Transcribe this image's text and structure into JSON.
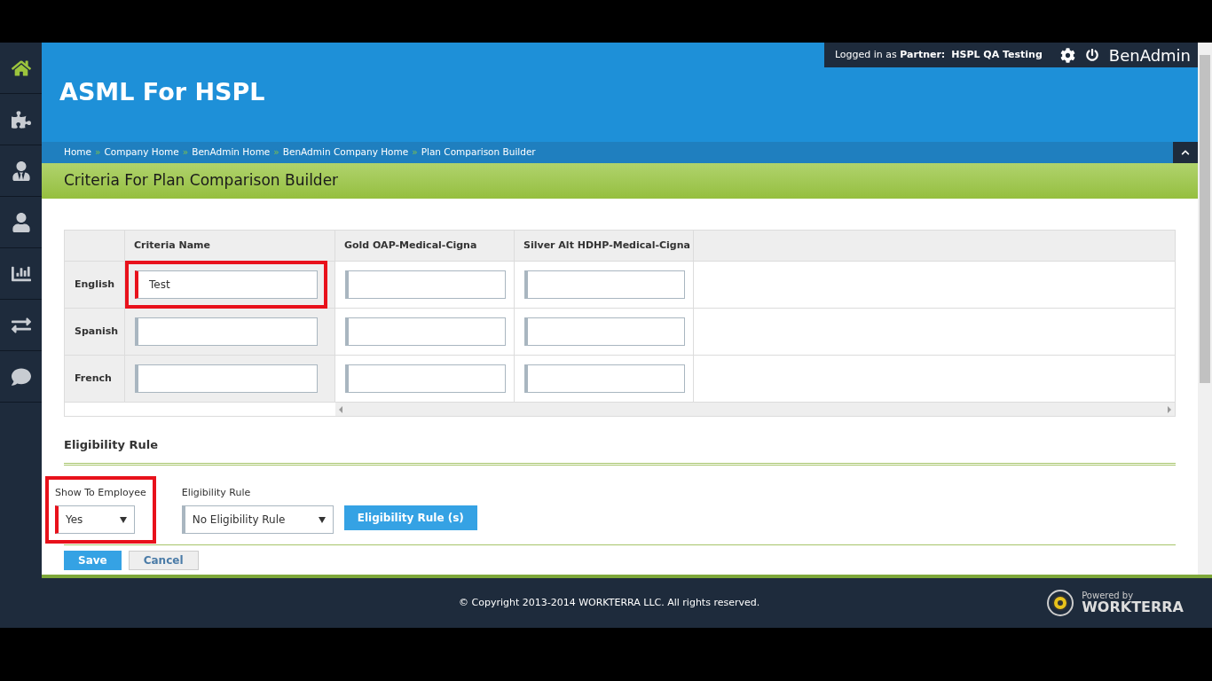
{
  "header": {
    "title": "ASML For HSPL",
    "user_bar": {
      "prefix": "Logged in as",
      "role": "Partner:",
      "name": "HSPL QA Testing",
      "app": "BenAdmin"
    }
  },
  "sidebar": {
    "items": [
      {
        "selected": true
      },
      {
        "selected": false
      },
      {
        "selected": false
      },
      {
        "selected": false
      },
      {
        "selected": false
      },
      {
        "selected": false
      },
      {
        "selected": false
      }
    ]
  },
  "breadcrumb": [
    "Home",
    "Company Home",
    "BenAdmin Home",
    "BenAdmin Company Home",
    "Plan Comparison Builder"
  ],
  "breadcrumb_separator": "»",
  "page_title": "Criteria For Plan Comparison Builder",
  "table": {
    "columns": [
      "Criteria Name",
      "Gold OAP-Medical-Cigna",
      "Silver Alt HDHP-Medical-Cigna"
    ],
    "rows": [
      {
        "language": "English",
        "values": [
          {
            "value": "Test",
            "required": true,
            "highlighted": true
          },
          {
            "required": false,
            "highlighted": false
          },
          {
            "required": false,
            "highlighted": false
          }
        ]
      },
      {
        "language": "Spanish",
        "values": [
          {
            "required": false,
            "highlighted": false
          },
          {
            "required": false,
            "highlighted": false
          },
          {
            "required": false,
            "highlighted": false
          }
        ]
      },
      {
        "language": "French",
        "values": [
          {
            "required": false,
            "highlighted": false
          },
          {
            "required": false,
            "highlighted": false
          },
          {
            "required": false,
            "highlighted": false
          }
        ]
      }
    ]
  },
  "eligibility": {
    "section_title": "Eligibility Rule",
    "show_to_employee": {
      "label": "Show To Employee",
      "value": "Yes",
      "required": true,
      "highlighted": true
    },
    "rule": {
      "label": "Eligibility Rule",
      "value": "No Eligibility Rule",
      "required": false,
      "highlighted": false
    },
    "rules_button": "Eligibility Rule (s)"
  },
  "buttons": [
    {
      "label": "Save",
      "kind": "primary"
    },
    {
      "label": "Cancel",
      "kind": "secondary"
    }
  ],
  "footer": {
    "copyright": "© Copyright 2013-2014 WORKTERRA LLC. All rights reserved.",
    "powered_by": "Powered by",
    "brand": "WORKTERRA"
  }
}
